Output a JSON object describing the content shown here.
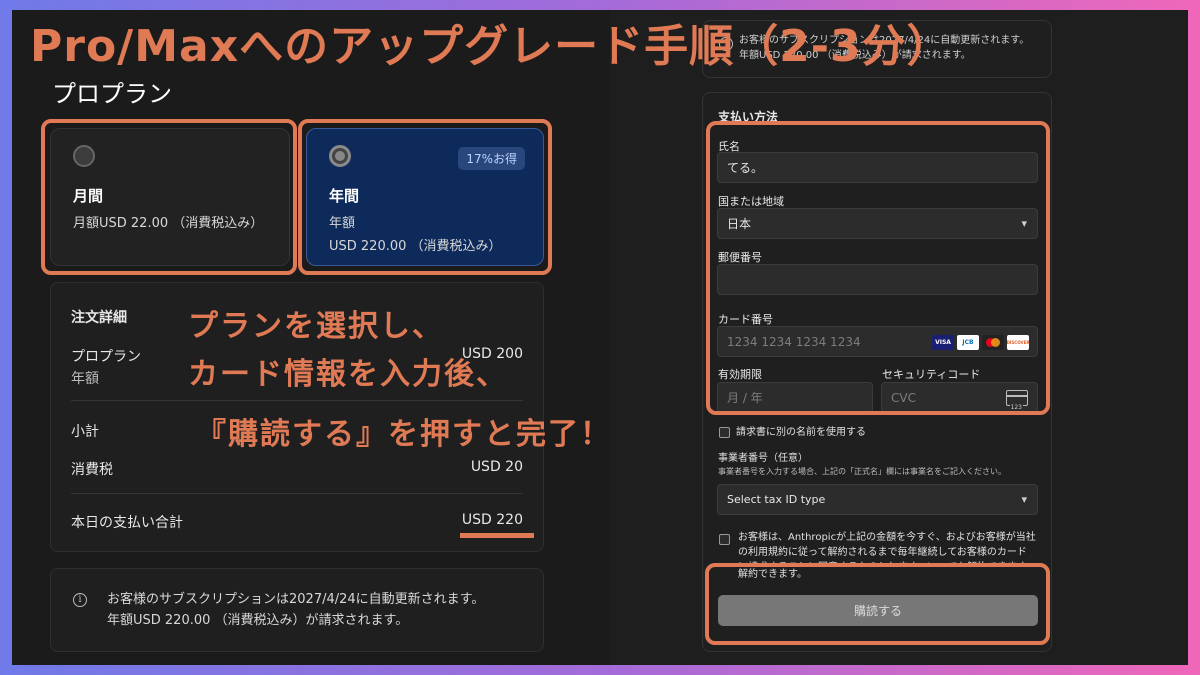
{
  "title": "Pro/Maxへのアップグレード手順（2-3分）",
  "plan_heading": "プロプラン",
  "plans": {
    "monthly": {
      "name": "月間",
      "price": "月額USD 22.00 （消費税込み）"
    },
    "yearly": {
      "badge": "17%お得",
      "name": "年間",
      "term": "年額",
      "price": "USD 220.00 （消費税込み）"
    }
  },
  "order": {
    "title": "注文詳細",
    "item_name": "プロプラン",
    "item_term": "年額",
    "item_price": "USD 200",
    "subtotal_label": "小計",
    "tax_label": "消費税",
    "tax_value": "USD 20",
    "total_label": "本日の支払い合計",
    "total_value": "USD 220"
  },
  "overlay": {
    "line1": "プランを選択し、",
    "line2": "カード情報を入力後、",
    "line3": "『購読する』を押すと完了！"
  },
  "notice": {
    "line1": "お客様のサブスクリプションは2027/4/24に自動更新されます。",
    "line2": "年額USD 220.00 （消費税込み）が請求されます。"
  },
  "top_notice": {
    "line1": "お客様のサブスクリプションは2027/4/24に自動更新されます。",
    "line2": "年額USD 220.00 （消費税込み）が請求されます。"
  },
  "payment": {
    "heading": "支払い方法",
    "name_label": "氏名",
    "name_value": "てる。",
    "country_label": "国または地域",
    "country_value": "日本",
    "postal_label": "郵便番号",
    "card_label": "カード番号",
    "card_placeholder": "1234 1234 1234 1234",
    "card_logos": [
      "VISA",
      "JCB",
      "MC",
      "DISCOVER"
    ],
    "expiry_label": "有効期限",
    "expiry_placeholder": "月 / 年",
    "cvc_label": "セキュリティコード",
    "cvc_placeholder": "CVC",
    "cvc_icon_number": "123",
    "billing_name_checkbox": "請求書に別の名前を使用する",
    "tax_id_label": "事業者番号（任意）",
    "tax_id_hint": "事業者番号を入力する場合、上記の「正式名」欄には事業名をご記入ください。",
    "tax_id_select": "Select tax ID type",
    "consent_text": "お客様は、Anthropicが上記の金額を今すぐ、およびお客様が当社の利用規約に従って解約されるまで毎年継続してお客様のカードに請求することに同意するものとします。いつでも解約できます。",
    "consent_tail": "解約できます。",
    "subscribe_button": "購読する"
  },
  "colors": {
    "accent": "#e07a55",
    "selected_card_bg": "#0d2a5a",
    "panel_bg": "#1f1f1f"
  }
}
